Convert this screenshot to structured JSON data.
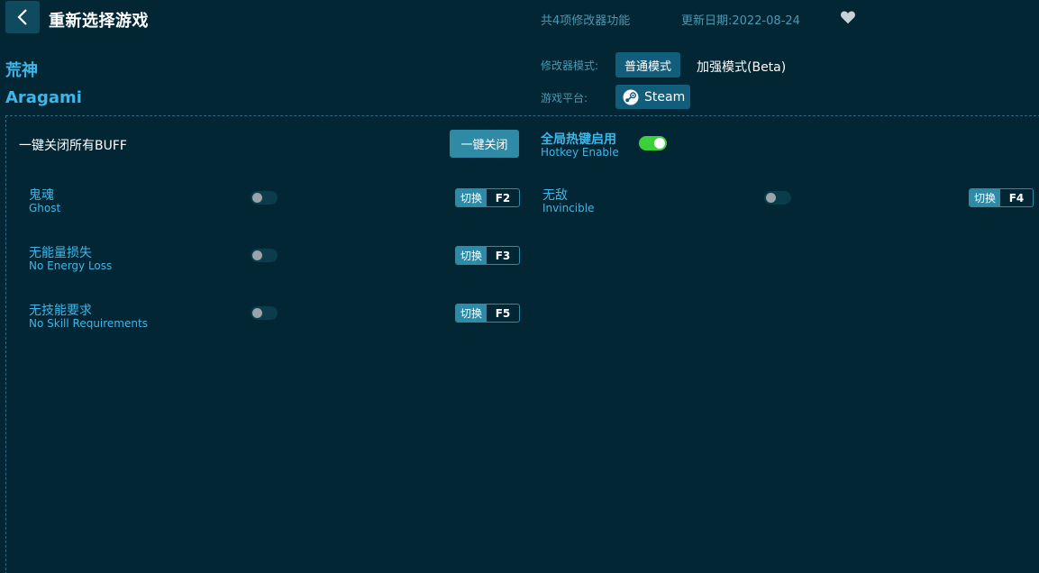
{
  "header": {
    "title": "重新选择游戏",
    "feature_count": "共4项修改器功能",
    "update_date": "更新日期:2022-08-24"
  },
  "game": {
    "name_cn": "荒神",
    "name_en": "Aragami"
  },
  "mode": {
    "label": "修改器模式:",
    "normal": "普通模式",
    "beta": "加强模式(Beta)"
  },
  "platform": {
    "label": "游戏平台:",
    "name": "Steam"
  },
  "buff": {
    "label": "一键关闭所有BUFF",
    "button": "一键关闭"
  },
  "hotkey_enable": {
    "cn": "全局热键启用",
    "en": "Hotkey Enable",
    "state": "on"
  },
  "switch_label": "切换",
  "cheats": [
    {
      "cn": "鬼魂",
      "en": "Ghost",
      "key": "F2",
      "state": "off"
    },
    {
      "cn": "无敌",
      "en": "Invincible",
      "key": "F4",
      "state": "off"
    },
    {
      "cn": "无能量损失",
      "en": "No Energy Loss",
      "key": "F3",
      "state": "off"
    },
    {
      "cn": "无技能要求",
      "en": "No Skill Requirements",
      "key": "F5",
      "state": "off"
    }
  ],
  "colors": {
    "background": "#022634",
    "accent": "#3fb6e8",
    "button": "#2f8aa6",
    "toggle_on": "#3ccf3c"
  }
}
